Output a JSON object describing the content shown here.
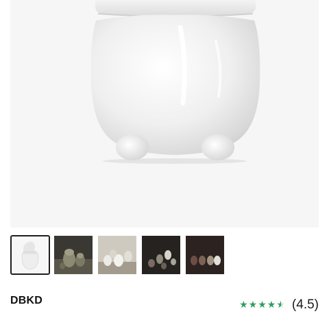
{
  "product": {
    "brand": "DBKD",
    "rating": {
      "value": 4.5,
      "display": "(4.5)",
      "stars_full": 4,
      "stars_half": 1,
      "star_color": "#2f9e5b"
    }
  },
  "gallery": {
    "main_image": {
      "description_icon": "white-ceramic-jar-image"
    },
    "thumbnails": [
      {
        "name": "thumb-1",
        "icon": "white-jar-thumbnail",
        "selected": true
      },
      {
        "name": "thumb-2",
        "icon": "green-jars-thumbnail",
        "selected": false
      },
      {
        "name": "thumb-3",
        "icon": "white-jars-thumbnail",
        "selected": false
      },
      {
        "name": "thumb-4",
        "icon": "dark-jars-thumbnail",
        "selected": false
      },
      {
        "name": "thumb-5",
        "icon": "brown-jars-thumbnail",
        "selected": false
      }
    ]
  },
  "colors": {
    "hero_background": "#f6f6f6",
    "selected_border": "#1f1f1f",
    "text": "#111111"
  }
}
